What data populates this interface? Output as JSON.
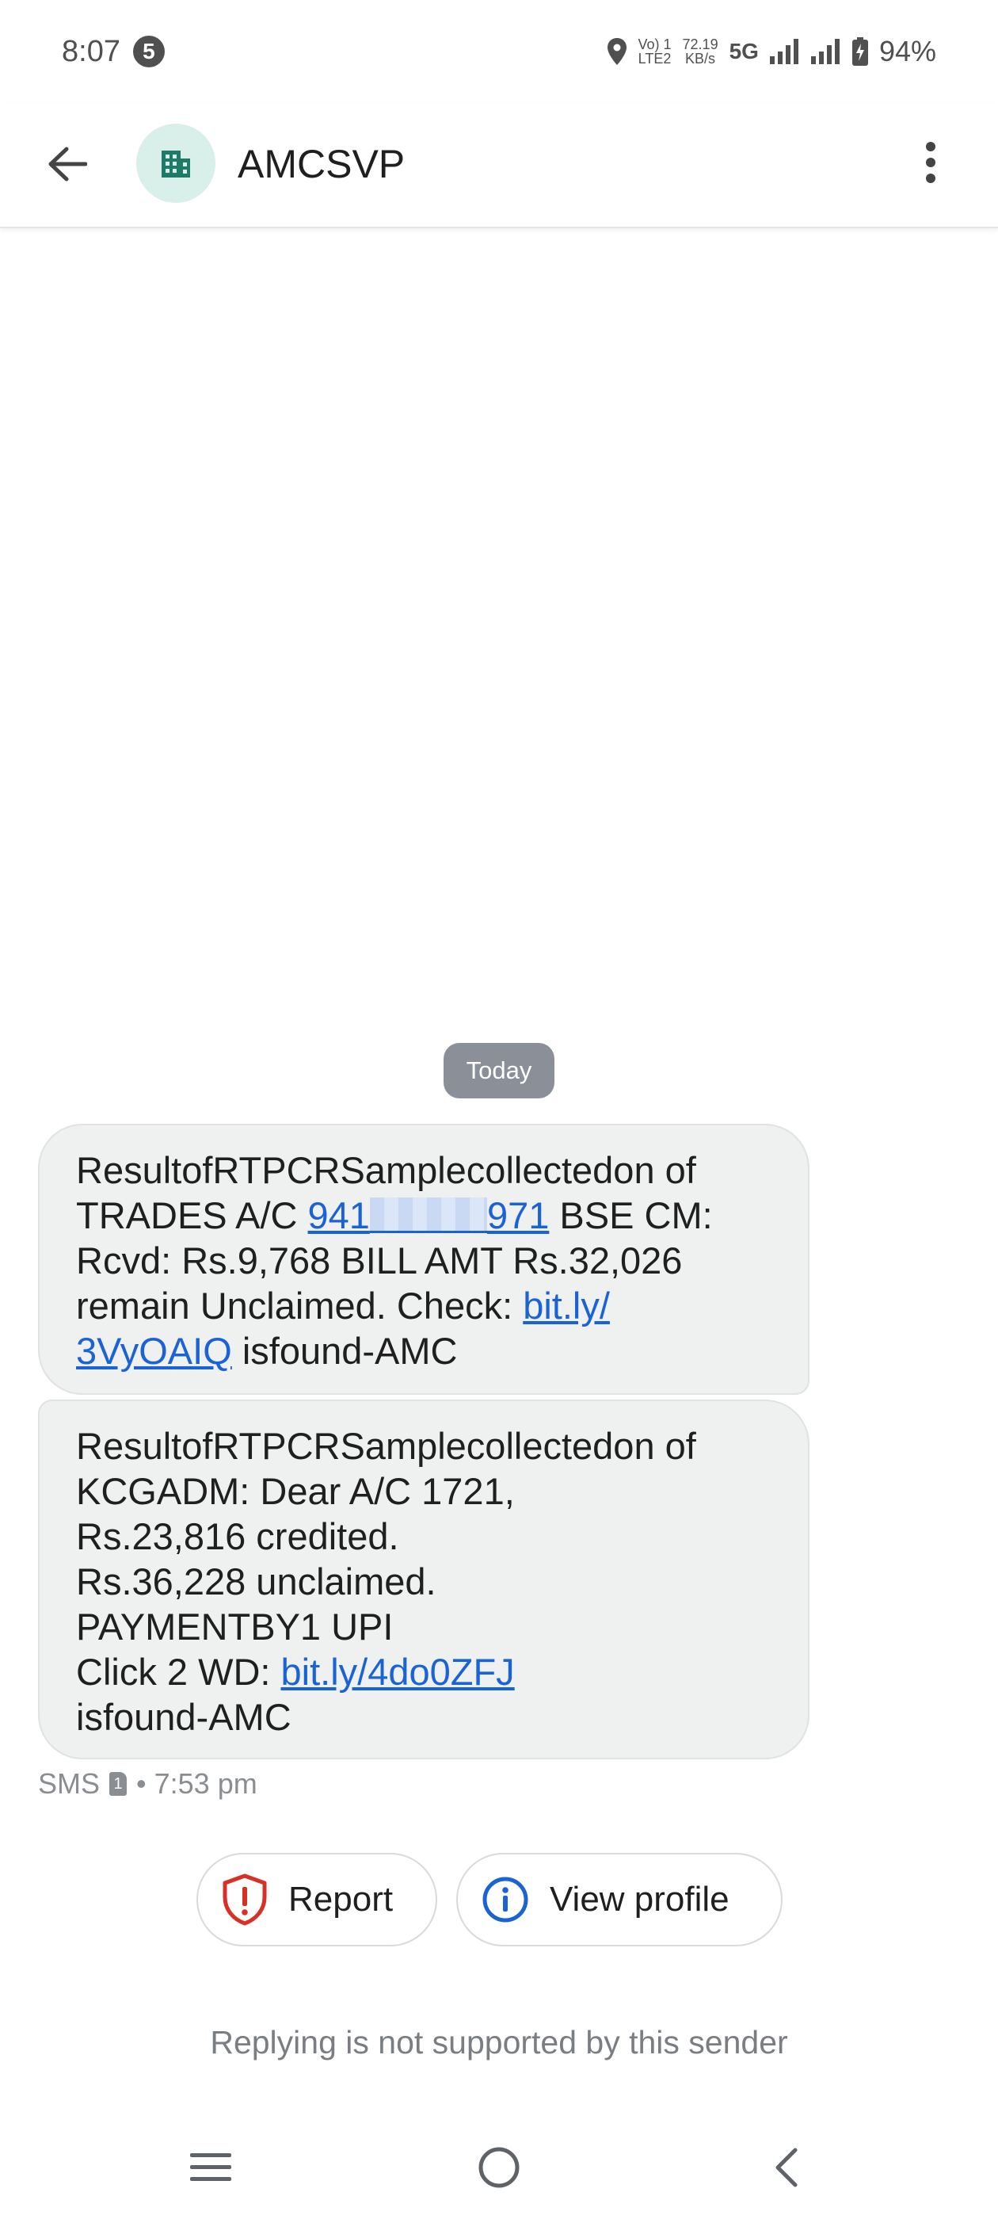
{
  "status_bar": {
    "time": "8:07",
    "notification_count": "5",
    "volte_top": "Vo) 1",
    "volte_bottom": "LTE2",
    "speed_value": "72.19",
    "speed_unit": "KB/s",
    "network": "5G",
    "battery": "94%"
  },
  "app_bar": {
    "contact_name": "AMCSVP"
  },
  "conversation": {
    "date_chip": "Today",
    "messages": [
      {
        "line1": "ResultofRTPCRSamplecollectedon of",
        "line2_pre": "TRADES A/C ",
        "account_start": "941",
        "account_end": "971",
        "line2_post": " BSE CM:",
        "line3": "Rcvd: Rs.9,768 BILL AMT Rs.32,026",
        "line4_pre": "remain Unclaimed. Check: ",
        "link_part1": "bit.ly/",
        "link_part2": "3VyOAIQ",
        "line5_post": " isfound-AMC"
      },
      {
        "line1": "ResultofRTPCRSamplecollectedon of",
        "line2": "KCGADM: Dear A/C 1721,",
        "line3": "Rs.23,816 credited.",
        "line4": "Rs.36,228 unclaimed.",
        "line5": "PAYMENTBY1 UPI",
        "line6_pre": "Click 2 WD: ",
        "link": "bit.ly/4do0ZFJ",
        "line7": "isfound-AMC"
      }
    ],
    "meta_type": "SMS",
    "meta_sim": "1",
    "meta_time": "• 7:53 pm"
  },
  "actions": {
    "report_label": "Report",
    "view_profile_label": "View profile"
  },
  "reply_note": "Replying is not supported by this sender",
  "colors": {
    "link": "#1a63d6",
    "bubble": "#eff0f0",
    "report_icon": "#d93025",
    "profile_icon": "#1a63d6",
    "avatar_bg": "#d9efe9",
    "avatar_icon": "#1f7a68"
  }
}
